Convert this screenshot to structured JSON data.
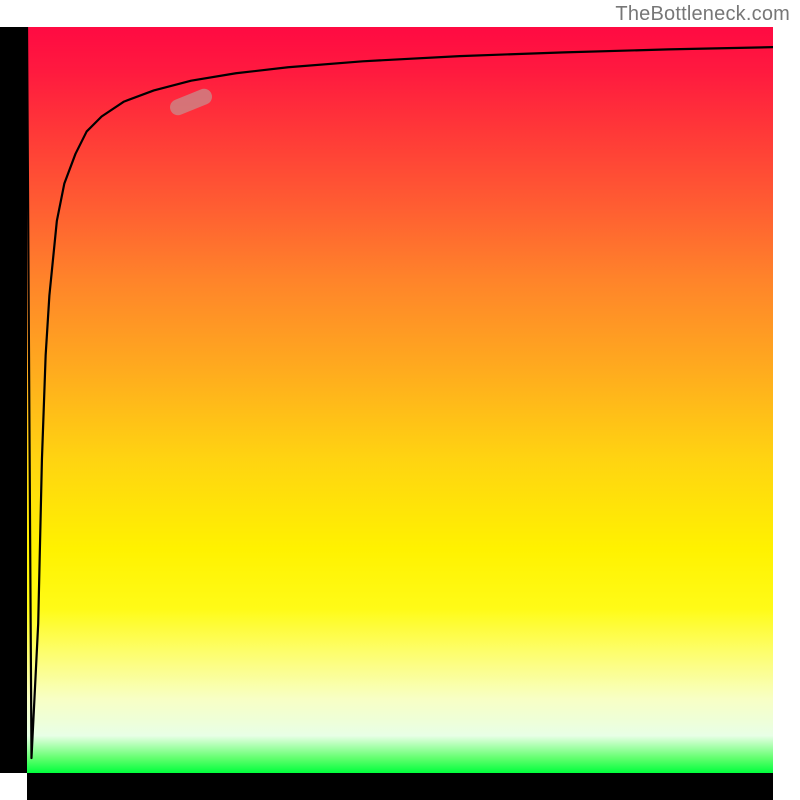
{
  "attribution": "TheBottleneck.com",
  "colors": {
    "axis": "#000000",
    "curve": "#000000",
    "marker": "rgba(200,140,140,0.75)"
  },
  "chart_data": {
    "type": "line",
    "title": "",
    "xlabel": "",
    "ylabel": "",
    "xlim": [
      0,
      100
    ],
    "ylim": [
      0,
      100
    ],
    "x": [
      0,
      0.6,
      1.5,
      2.0,
      2.5,
      3.0,
      4.0,
      5.0,
      6.5,
      8.0,
      10.0,
      13.0,
      17.0,
      22.0,
      28.0,
      35.0,
      45.0,
      58.0,
      72.0,
      86.0,
      100.0
    ],
    "values": [
      100,
      2,
      20,
      42,
      56,
      64,
      74,
      79,
      83,
      86,
      88,
      90,
      91.5,
      92.8,
      93.8,
      94.6,
      95.4,
      96.1,
      96.6,
      97.0,
      97.3
    ],
    "marker": {
      "x": 22,
      "y": 90,
      "angle_deg": -22
    },
    "gradient_stops": [
      {
        "pos": 0.0,
        "color": "#ff0a42"
      },
      {
        "pos": 0.14,
        "color": "#ff3838"
      },
      {
        "pos": 0.34,
        "color": "#ff842a"
      },
      {
        "pos": 0.58,
        "color": "#ffd411"
      },
      {
        "pos": 0.78,
        "color": "#fffb17"
      },
      {
        "pos": 0.95,
        "color": "#e8ffe6"
      },
      {
        "pos": 1.0,
        "color": "#00ff3c"
      }
    ]
  }
}
